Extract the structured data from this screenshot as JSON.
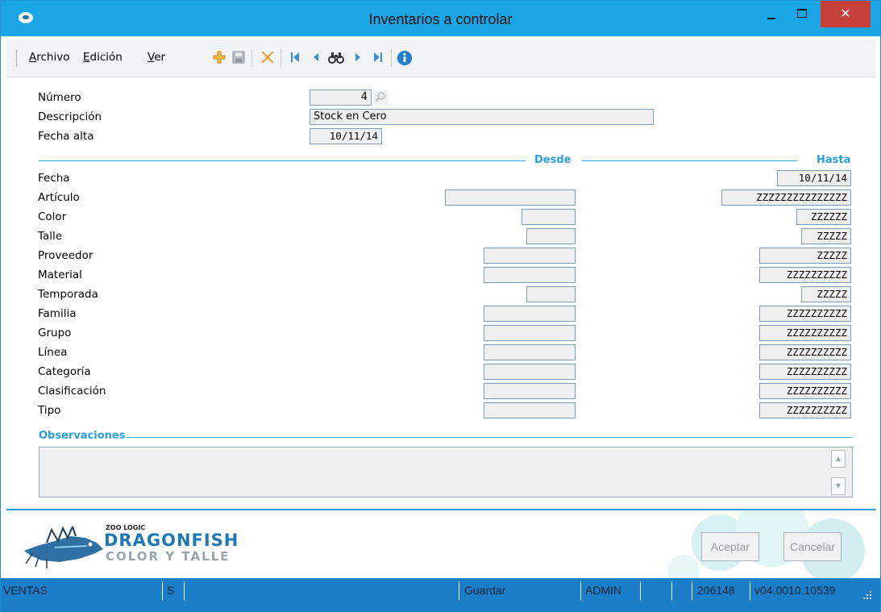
{
  "window": {
    "title": "Inventarios a controlar",
    "close_glyph": "✕"
  },
  "menu": {
    "archivo_first": "A",
    "archivo_rest": "rchivo",
    "edicion_first": "E",
    "edicion_rest": "dición",
    "ver_first": "V",
    "ver_rest": "er"
  },
  "toolbar_icons": [
    "add-icon",
    "save-icon",
    "delete-icon",
    "first-record-icon",
    "previous-record-icon",
    "search-binoculars-icon",
    "next-record-icon",
    "last-record-icon",
    "info-icon"
  ],
  "header_fields": {
    "numero_label": "Número",
    "numero_value": "4",
    "descripcion_label": "Descripción",
    "descripcion_value": "Stock en Cero",
    "fecha_alta_label": "Fecha alta",
    "fecha_alta_value": "10/11/14"
  },
  "range": {
    "desde_label": "Desde",
    "hasta_label": "Hasta",
    "rows": [
      {
        "label": "Fecha",
        "desde": "",
        "hasta": "10/11/14"
      },
      {
        "label": "Artículo",
        "desde": "",
        "hasta": "ZZZZZZZZZZZZZZZ"
      },
      {
        "label": "Color",
        "desde": "",
        "hasta": "ZZZZZZ"
      },
      {
        "label": "Talle",
        "desde": "",
        "hasta": "ZZZZZ"
      },
      {
        "label": "Proveedor",
        "desde": "",
        "hasta": "ZZZZZ"
      },
      {
        "label": "Material",
        "desde": "",
        "hasta": "ZZZZZZZZZZ"
      },
      {
        "label": "Temporada",
        "desde": "",
        "hasta": "ZZZZZ"
      },
      {
        "label": "Familia",
        "desde": "",
        "hasta": "ZZZZZZZZZZ"
      },
      {
        "label": "Grupo",
        "desde": "",
        "hasta": "ZZZZZZZZZZ"
      },
      {
        "label": "Línea",
        "desde": "",
        "hasta": "ZZZZZZZZZZ"
      },
      {
        "label": "Categoría",
        "desde": "",
        "hasta": "ZZZZZZZZZZ"
      },
      {
        "label": "Clasificación",
        "desde": "",
        "hasta": "ZZZZZZZZZZ"
      },
      {
        "label": "Tipo",
        "desde": "",
        "hasta": "ZZZZZZZZZZ"
      }
    ]
  },
  "observaciones": {
    "label": "Observaciones",
    "value": ""
  },
  "logo": {
    "small": "ZOO LOGIC",
    "big": "DRAGONFISH",
    "sub": "COLOR Y TALLE"
  },
  "buttons": {
    "aceptar": "Aceptar",
    "cancelar": "Cancelar"
  },
  "statusbar": {
    "module": "VENTAS",
    "flag": "S",
    "action": "Guardar",
    "user": "ADMIN",
    "number": "206148",
    "version": "v04.0010.10539"
  },
  "colors": {
    "titlebar": "#1aa5e6",
    "accent": "#2aa0d6",
    "statusbar": "#1a7ec8",
    "close": "#c7403a"
  }
}
